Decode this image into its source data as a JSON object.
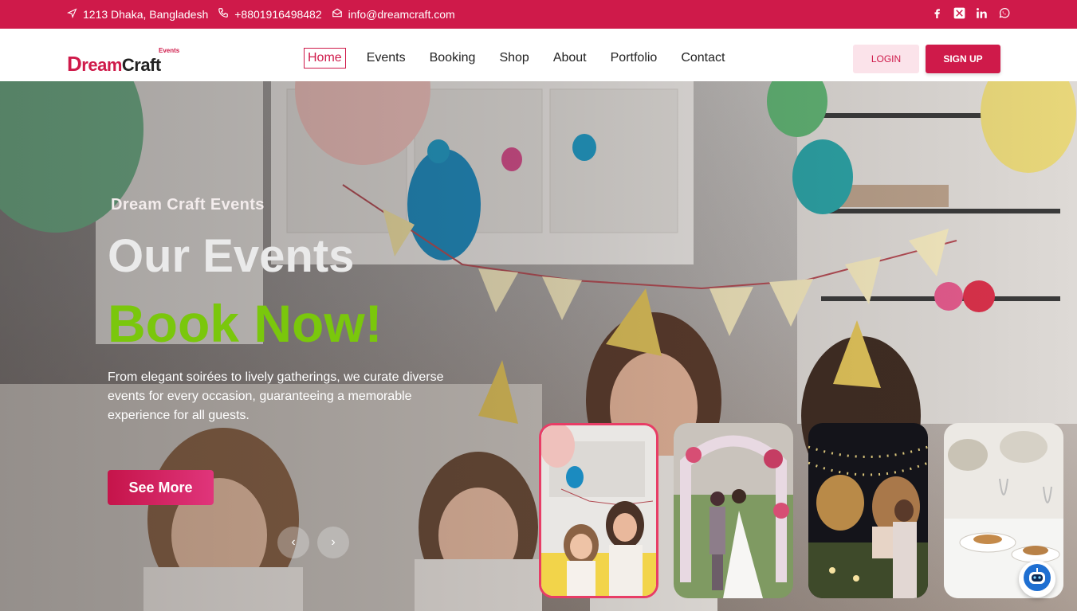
{
  "topbar": {
    "address": "1213 Dhaka, Bangladesh",
    "phone": "+8801916498482",
    "email": "info@dreamcraft.com",
    "socials": [
      "facebook-icon",
      "x-icon",
      "linkedin-icon",
      "whatsapp-icon"
    ]
  },
  "header": {
    "logo": {
      "tag": "Events",
      "d": "D",
      "ream": "ream",
      "craft": "Craft"
    },
    "nav": [
      "Home",
      "Events",
      "Booking",
      "Shop",
      "About",
      "Portfolio",
      "Contact"
    ],
    "active_nav": "Home",
    "login_label": "LOGIN",
    "signup_label": "SIGN UP"
  },
  "hero": {
    "subtitle": "Dream Craft Events",
    "title": "Our Events",
    "highlight": "Book Now!",
    "description": "From elegant soirées to lively gatherings, we curate diverse events for every occasion, guaranteeing a memorable experience for all guests.",
    "cta_label": "See More",
    "prev_label": "‹",
    "next_label": "›"
  },
  "colors": {
    "brand": "#cf1a4a",
    "highlight": "#7ac70c"
  }
}
